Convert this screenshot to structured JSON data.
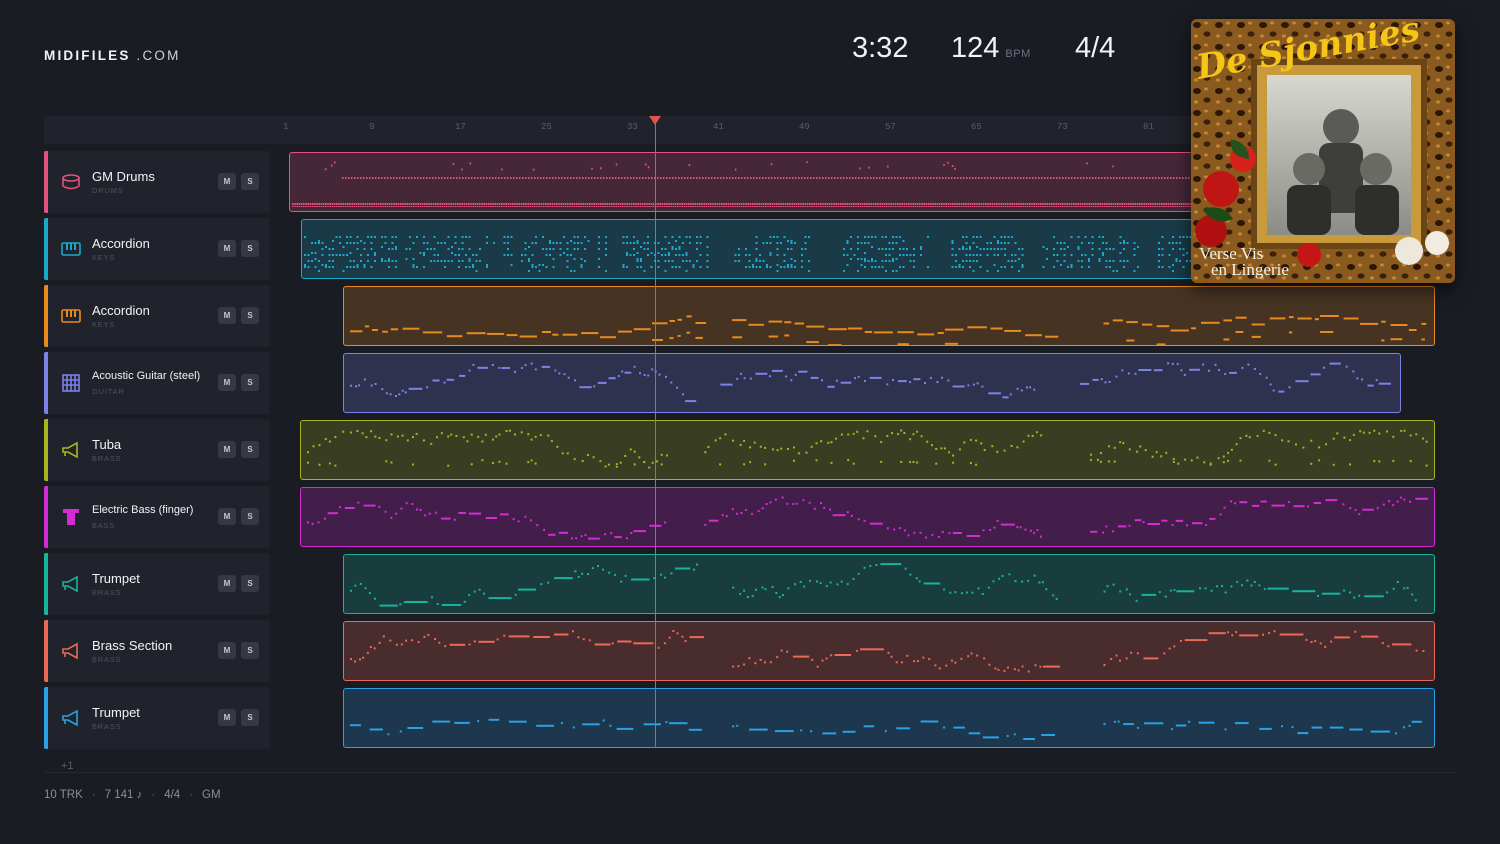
{
  "header": {
    "logo_bold": "MIDIFILES",
    "logo_suffix": ".COM",
    "time": "3:32",
    "bpm": "124",
    "bpm_unit": "BPM",
    "time_signature": "4/4"
  },
  "ruler": {
    "bars": [
      "1",
      "9",
      "17",
      "25",
      "33",
      "41",
      "49",
      "57",
      "65",
      "73",
      "81"
    ]
  },
  "tracks": [
    {
      "name": "GM Drums",
      "category": "DRUMS",
      "color": "#e2537f",
      "icon": "drum-icon"
    },
    {
      "name": "Accordion",
      "category": "KEYS",
      "color": "#1aa9c9",
      "icon": "keyboard-icon"
    },
    {
      "name": "Accordion",
      "category": "KEYS",
      "color": "#e98a1f",
      "icon": "keyboard-icon"
    },
    {
      "name": "Acoustic Guitar (steel)",
      "category": "GUITAR",
      "color": "#7b82e8",
      "icon": "guitar-icon"
    },
    {
      "name": "Tuba",
      "category": "BRASS",
      "color": "#a7b51e",
      "icon": "horn-icon"
    },
    {
      "name": "Electric Bass (finger)",
      "category": "BASS",
      "color": "#d52bd5",
      "icon": "bass-icon"
    },
    {
      "name": "Trumpet",
      "category": "BRASS",
      "color": "#18b39b",
      "icon": "horn-icon"
    },
    {
      "name": "Brass Section",
      "category": "BRASS",
      "color": "#ec6a55",
      "icon": "horn-icon"
    },
    {
      "name": "Trumpet",
      "category": "BRASS",
      "color": "#2aa0e6",
      "icon": "horn-icon"
    }
  ],
  "track_buttons": {
    "mute": "M",
    "solo": "S"
  },
  "more_tracks": "+1",
  "footer": {
    "tracks": "10 TRK",
    "notes": "7 141 ♪",
    "signature": "4/4",
    "standard": "GM"
  },
  "album": {
    "artist": "De Sjonnies",
    "title_line1": "Verse Vis",
    "title_line2": "en Lingerie"
  }
}
